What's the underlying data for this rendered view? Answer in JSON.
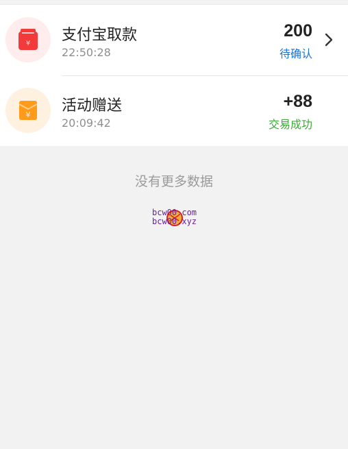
{
  "records": [
    {
      "title": "支付宝取款",
      "time": "22:50:28",
      "amount": "200",
      "status": "待确认",
      "status_color": "#1a73d9",
      "icon": "red-envelope-icon",
      "icon_color": "#f23a3a"
    },
    {
      "title": "活动赠送",
      "time": "20:09:42",
      "amount": "+88",
      "status": "交易成功",
      "status_color": "#3aaa35",
      "icon": "gift-envelope-icon",
      "icon_color": "#ff9a1a"
    }
  ],
  "footer": {
    "no_more_text": "没有更多数据"
  },
  "watermark": {
    "line1": "bcw00.com",
    "line2": "bcw00.xyz"
  }
}
